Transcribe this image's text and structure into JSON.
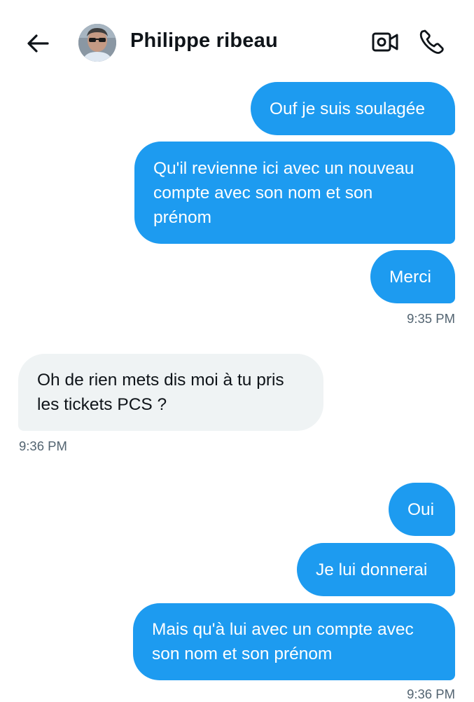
{
  "header": {
    "contact_name": "Philippe ribeau",
    "icons": {
      "back": "arrow-left-icon",
      "avatar": "avatar",
      "video": "video-camera-icon",
      "call": "phone-icon"
    }
  },
  "colors": {
    "sent_bubble": "#1d9bf0",
    "received_bubble": "#eff3f4",
    "timestamp": "#536471"
  },
  "messages": [
    {
      "direction": "sent",
      "text": "Ouf je suis soulagée"
    },
    {
      "direction": "sent",
      "text": "Qu'il revienne ici avec un nouveau\ncompte avec son nom et son\nprénom"
    },
    {
      "direction": "sent",
      "text": "Merci"
    },
    {
      "timestamp": "9:35 PM"
    },
    {
      "direction": "received",
      "text": "Oh de rien mets dis moi à tu pris\nles tickets PCS ?"
    },
    {
      "timestamp": "9:36 PM"
    },
    {
      "direction": "sent",
      "text": "Oui"
    },
    {
      "direction": "sent",
      "text": "Je lui donnerai"
    },
    {
      "direction": "sent",
      "text": "Mais qu'à lui avec un compte avec\nson nom et  son prénom"
    },
    {
      "timestamp": "9:36 PM"
    }
  ]
}
